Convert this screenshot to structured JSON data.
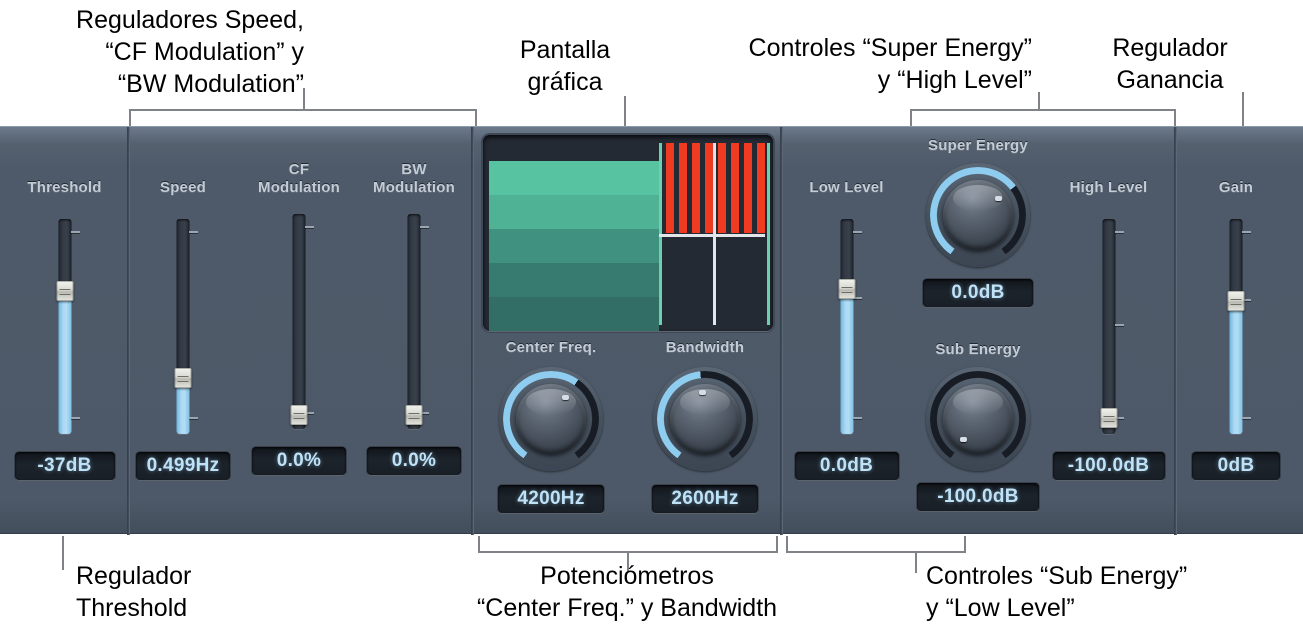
{
  "annotations": {
    "top_left": "Reguladores Speed,\n“CF Modulation” y\n“BW Modulation”",
    "top_display": "Pantalla\ngráfica",
    "top_super": "Controles “Super Energy”\ny “High Level”",
    "top_gain": "Regulador\nGanancia",
    "bottom_thresh": "Regulador\nThreshold",
    "bottom_knobs": "Potenciómetros\n“Center Freq.” y Bandwidth",
    "bottom_sub": "Controles “Sub Energy”\ny “Low Level”"
  },
  "plugin": {
    "controls": {
      "threshold": {
        "label": "Threshold",
        "value": "-37dB",
        "type": "slider",
        "fill_pct": 67,
        "thumb_pct": 33
      },
      "speed": {
        "label": "Speed",
        "value": "0.499Hz",
        "type": "slider",
        "fill_pct": 26,
        "thumb_pct": 74
      },
      "cf_modulation": {
        "label": "CF\nModulation",
        "value": "0.0%",
        "type": "slider",
        "fill_pct": 0,
        "thumb_pct": 100
      },
      "bw_modulation": {
        "label": "BW\nModulation",
        "value": "0.0%",
        "type": "slider",
        "fill_pct": 0,
        "thumb_pct": 100
      },
      "center_freq": {
        "label": "Center Freq.",
        "value": "4200Hz",
        "type": "knob",
        "arc_pct": 62
      },
      "bandwidth": {
        "label": "Bandwidth",
        "value": "2600Hz",
        "type": "knob",
        "arc_pct": 48
      },
      "low_level": {
        "label": "Low Level",
        "value": "0.0dB",
        "type": "slider",
        "fill_pct": 68,
        "thumb_pct": 32
      },
      "super_energy": {
        "label": "Super Energy",
        "value": "0.0dB",
        "type": "knob",
        "arc_pct": 68
      },
      "sub_energy": {
        "label": "Sub Energy",
        "value": "-100.0dB",
        "type": "knob",
        "arc_pct": 0
      },
      "high_level": {
        "label": "High Level",
        "value": "-100.0dB",
        "type": "slider",
        "fill_pct": 0,
        "thumb_pct": 94
      },
      "gain": {
        "label": "Gain",
        "value": "0dB",
        "type": "slider",
        "fill_pct": 62,
        "thumb_pct": 38
      }
    },
    "display": {
      "background": "#242a34",
      "green_bands": [
        "#57c3a0",
        "#50b295",
        "#419181",
        "#367a70",
        "#326e66"
      ],
      "red_bar_color": "#ef3b21",
      "marker_teal": "#6ecfae",
      "marker_white": "#e2e6ea",
      "red_bar_count": 8
    },
    "colors": {
      "panel_top": "#6c7a8b",
      "panel_body": "#4d5968",
      "slider_fill": "#a8d8f2",
      "readout_text": "#bfe2f7",
      "label_text": "#c3ccd6",
      "knob_arc": "#8fcdf0"
    }
  }
}
